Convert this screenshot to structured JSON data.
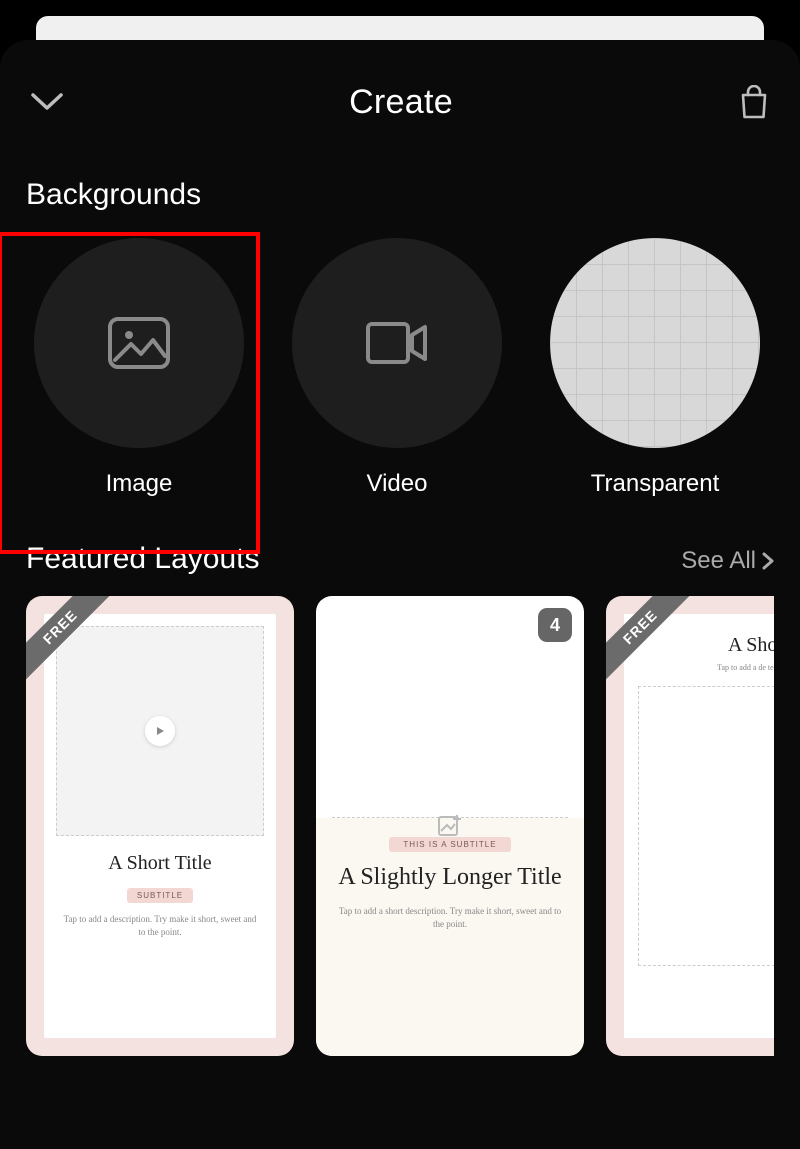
{
  "header": {
    "title": "Create"
  },
  "sections": {
    "backgrounds": {
      "title": "Backgrounds",
      "items": [
        {
          "label": "Image"
        },
        {
          "label": "Video"
        },
        {
          "label": "Transparent"
        }
      ]
    },
    "layouts": {
      "title": "Featured Layouts",
      "see_all": "See All",
      "cards": [
        {
          "badge": "FREE",
          "title": "A Short Title",
          "subtitle_pill": "SUBTITLE",
          "description": "Tap to add a description. Try make it short, sweet and to the point."
        },
        {
          "count": "4",
          "subtitle_pill": "THIS IS A SUBTITLE",
          "title": "A Slightly Longer Title",
          "description": "Tap to add a short description. Try make it short, sweet and to the point."
        },
        {
          "badge": "FREE",
          "title": "A Shor",
          "description": "Tap to add a de\ntell your"
        }
      ]
    }
  },
  "highlight": {
    "target": "background-image"
  }
}
